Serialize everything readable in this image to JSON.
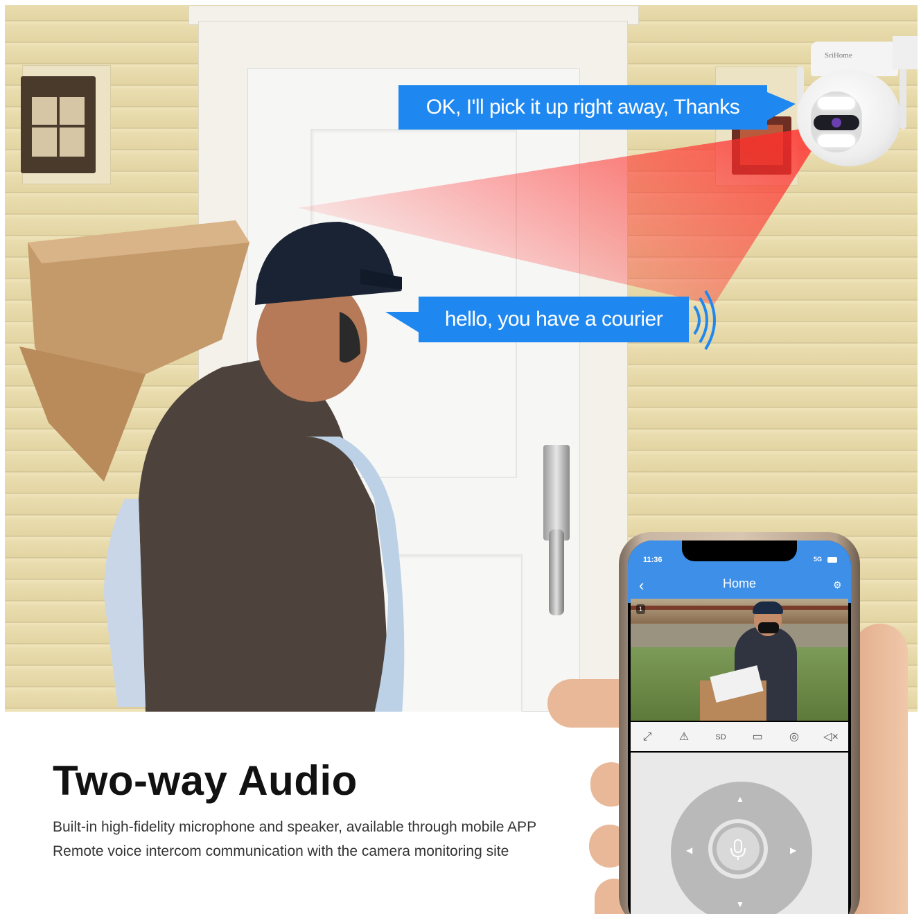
{
  "bubbles": {
    "camera_reply": "OK, I'll pick it up right away, Thanks",
    "courier_greeting": "hello,  you have a courier"
  },
  "camera": {
    "brand": "SriHome"
  },
  "phone": {
    "status_time": "11:36",
    "status_signal": "5G",
    "app_title": "Home",
    "video_badge": "1",
    "toolbar": [
      "fullscreen-icon",
      "alarm-icon",
      "SD",
      "record-icon",
      "snapshot-icon",
      "mute-icon"
    ],
    "sd_label": "SD"
  },
  "headline": "Two-way Audio",
  "description": [
    "Built-in high-fidelity microphone and speaker, available through mobile APP",
    "Remote voice intercom communication with the camera monitoring site"
  ],
  "colors": {
    "bubble": "#1f88f0",
    "app_bar": "#3d8fe8",
    "beam": "#ff2a2a"
  }
}
